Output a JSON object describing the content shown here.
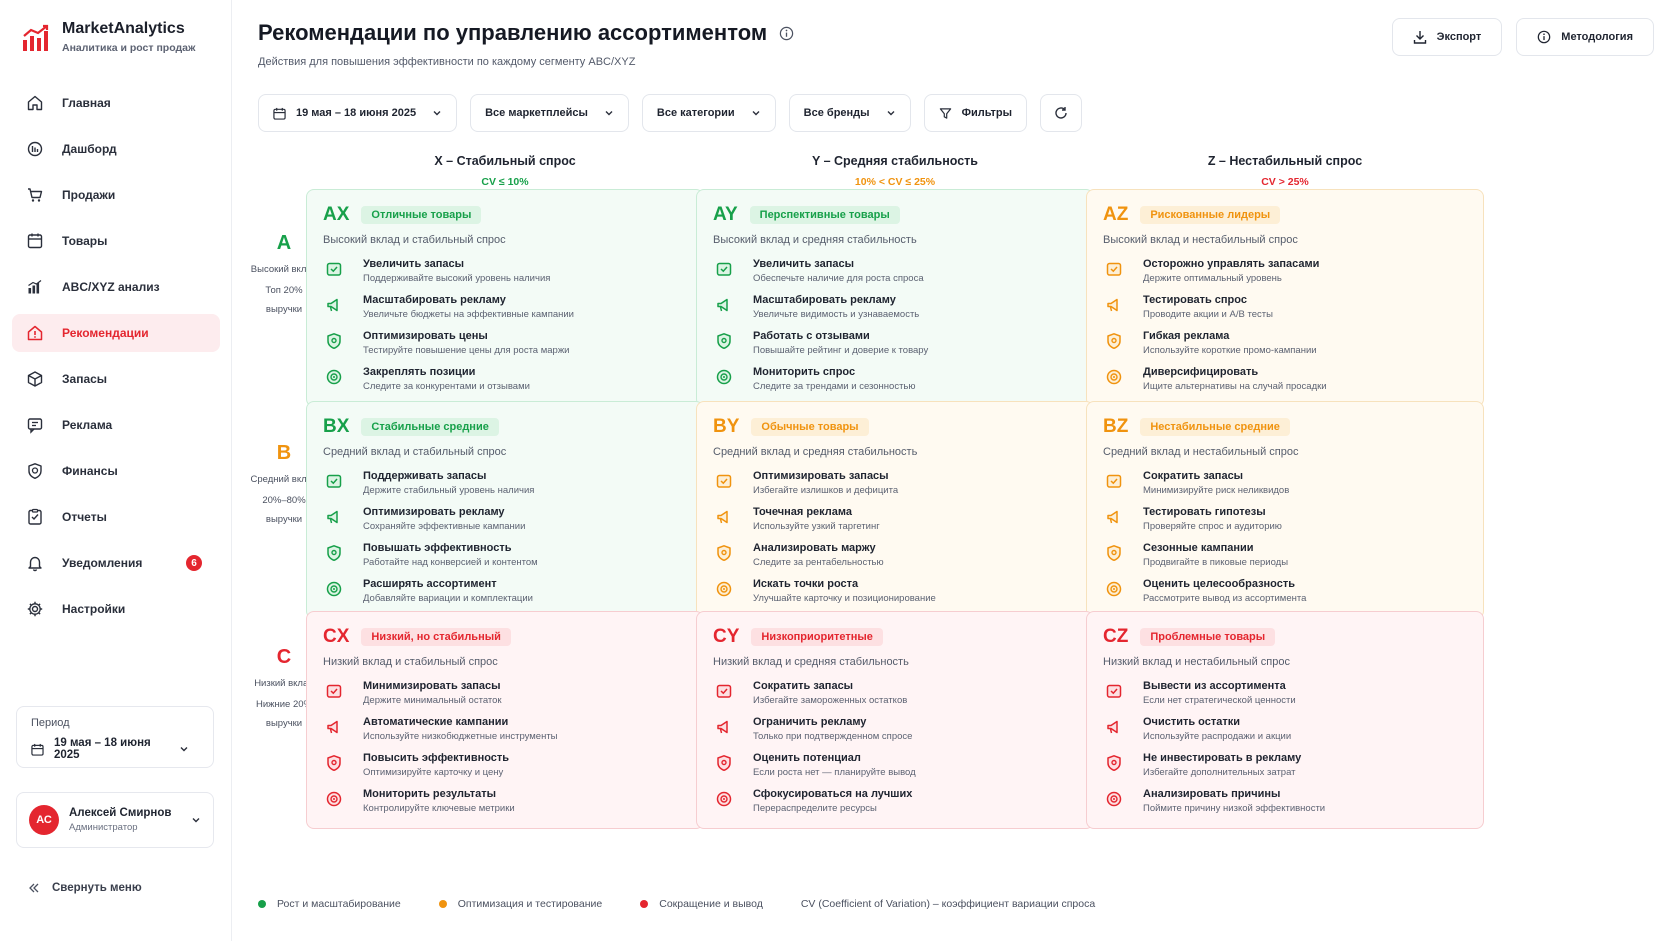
{
  "brand": {
    "title": "MarketAnalytics",
    "subtitle": "Аналитика и рост продаж"
  },
  "nav": [
    {
      "label": "Главная",
      "icon": "home-icon"
    },
    {
      "label": "Дашборд",
      "icon": "dashboard-icon"
    },
    {
      "label": "Продажи",
      "icon": "cart-icon"
    },
    {
      "label": "Товары",
      "icon": "box-icon"
    },
    {
      "label": "ABC/XYZ анализ",
      "icon": "bar-chart-icon"
    },
    {
      "label": "Рекомендации",
      "icon": "home-alert-icon",
      "active": true
    },
    {
      "label": "Запасы",
      "icon": "stock-icon"
    },
    {
      "label": "Реклама",
      "icon": "ad-icon"
    },
    {
      "label": "Финансы",
      "icon": "finance-icon"
    },
    {
      "label": "Отчеты",
      "icon": "report-icon"
    },
    {
      "label": "Уведомления",
      "icon": "bell-icon",
      "badge": "6"
    },
    {
      "label": "Настройки",
      "icon": "gear-icon"
    }
  ],
  "period": {
    "label": "Период",
    "value": "19 мая – 18 июня 2025"
  },
  "user": {
    "initials": "АС",
    "name": "Алексей Смирнов",
    "role": "Администратор"
  },
  "collapse_label": "Свернуть меню",
  "header": {
    "title": "Рекомендации по управлению ассортиментом",
    "subtitle": "Действия для повышения эффективности по каждому сегменту ABC/XYZ",
    "export_label": "Экспорт",
    "method_label": "Методология"
  },
  "filters": {
    "date": "19 мая – 18 июня 2025",
    "marketplaces": "Все маркетплейсы",
    "categories": "Все категории",
    "brands": "Все бренды",
    "filters_label": "Фильтры"
  },
  "columns": [
    {
      "title": "X – Стабильный спрос",
      "sub": "CV ≤ 10%",
      "color": "#17a04a"
    },
    {
      "title": "Y – Средняя стабильность",
      "sub": "10% < CV ≤ 25%",
      "color": "#f0930f"
    },
    {
      "title": "Z – Нестабильный спрос",
      "sub": "CV > 25%",
      "color": "#e4262f"
    }
  ],
  "rows": [
    {
      "letter": "A",
      "color": "#17a04a",
      "desc": "Высокий вклад",
      "pct": "Топ 20%",
      "unit": "выручки"
    },
    {
      "letter": "B",
      "color": "#f0930f",
      "desc": "Средний вклад",
      "pct": "20%–80%",
      "unit": "выручки"
    },
    {
      "letter": "C",
      "color": "#e4262f",
      "desc": "Низкий вклад",
      "pct": "Нижние 20%",
      "unit": "выручки"
    }
  ],
  "cards": [
    {
      "code": "AX",
      "tone": "g",
      "tag": "Отличные товары",
      "desc": "Высокий вклад и стабильный спрос",
      "actions": [
        {
          "name": "Увеличить запасы",
          "desc": "Поддерживайте высокий уровень наличия"
        },
        {
          "name": "Масштабировать рекламу",
          "desc": "Увеличьте бюджеты на эффективные кампании"
        },
        {
          "name": "Оптимизировать цены",
          "desc": "Тестируйте повышение цены для роста маржи"
        },
        {
          "name": "Закреплять позиции",
          "desc": "Следите за конкурентами и отзывами"
        }
      ]
    },
    {
      "code": "AY",
      "tone": "g",
      "tag": "Перспективные товары",
      "desc": "Высокий вклад и средняя стабильность",
      "actions": [
        {
          "name": "Увеличить запасы",
          "desc": "Обеспечьте наличие для роста спроса"
        },
        {
          "name": "Масштабировать рекламу",
          "desc": "Увеличьте видимость и узнаваемость"
        },
        {
          "name": "Работать с отзывами",
          "desc": "Повышайте рейтинг и доверие к товару"
        },
        {
          "name": "Мониторить спрос",
          "desc": "Следите за трендами и сезонностью"
        }
      ]
    },
    {
      "code": "AZ",
      "tone": "o",
      "tag": "Рискованные лидеры",
      "desc": "Высокий вклад и нестабильный спрос",
      "actions": [
        {
          "name": "Осторожно управлять запасами",
          "desc": "Держите оптимальный уровень"
        },
        {
          "name": "Тестировать спрос",
          "desc": "Проводите акции и A/B тесты"
        },
        {
          "name": "Гибкая реклама",
          "desc": "Используйте короткие промо-кампании"
        },
        {
          "name": "Диверсифицировать",
          "desc": "Ищите альтернативы на случай просадки"
        }
      ]
    },
    {
      "code": "BX",
      "tone": "g",
      "tag": "Стабильные средние",
      "desc": "Средний вклад и стабильный спрос",
      "actions": [
        {
          "name": "Поддерживать запасы",
          "desc": "Держите стабильный уровень наличия"
        },
        {
          "name": "Оптимизировать рекламу",
          "desc": "Сохраняйте эффективные кампании"
        },
        {
          "name": "Повышать эффективность",
          "desc": "Работайте над конверсией и контентом"
        },
        {
          "name": "Расширять ассортимент",
          "desc": "Добавляйте вариации и комплектации"
        }
      ]
    },
    {
      "code": "BY",
      "tone": "o",
      "tag": "Обычные товары",
      "desc": "Средний вклад и средняя стабильность",
      "actions": [
        {
          "name": "Оптимизировать запасы",
          "desc": "Избегайте излишков и дефицита"
        },
        {
          "name": "Точечная реклама",
          "desc": "Используйте узкий таргетинг"
        },
        {
          "name": "Анализировать маржу",
          "desc": "Следите за рентабельностью"
        },
        {
          "name": "Искать точки роста",
          "desc": "Улучшайте карточку и позиционирование"
        }
      ]
    },
    {
      "code": "BZ",
      "tone": "o",
      "tag": "Нестабильные средние",
      "desc": "Средний вклад и нестабильный спрос",
      "actions": [
        {
          "name": "Сократить запасы",
          "desc": "Минимизируйте риск неликвидов"
        },
        {
          "name": "Тестировать гипотезы",
          "desc": "Проверяйте спрос и аудиторию"
        },
        {
          "name": "Сезонные кампании",
          "desc": "Продвигайте в пиковые периоды"
        },
        {
          "name": "Оценить целесообразность",
          "desc": "Рассмотрите вывод из ассортимента"
        }
      ]
    },
    {
      "code": "CX",
      "tone": "r",
      "tag": "Низкий, но стабильный",
      "desc": "Низкий вклад и стабильный спрос",
      "actions": [
        {
          "name": "Минимизировать запасы",
          "desc": "Держите минимальный остаток"
        },
        {
          "name": "Автоматические кампании",
          "desc": "Используйте низкобюджетные инструменты"
        },
        {
          "name": "Повысить эффективность",
          "desc": "Оптимизируйте карточку и цену"
        },
        {
          "name": "Мониторить результаты",
          "desc": "Контролируйте ключевые метрики"
        }
      ]
    },
    {
      "code": "CY",
      "tone": "r",
      "tag": "Низкоприоритетные",
      "desc": "Низкий вклад и средняя стабильность",
      "actions": [
        {
          "name": "Сократить запасы",
          "desc": "Избегайте замороженных остатков"
        },
        {
          "name": "Ограничить рекламу",
          "desc": "Только при подтвержденном спросе"
        },
        {
          "name": "Оценить потенциал",
          "desc": "Если роста нет — планируйте вывод"
        },
        {
          "name": "Сфокусироваться на лучших",
          "desc": "Перераспределите ресурсы"
        }
      ]
    },
    {
      "code": "CZ",
      "tone": "r",
      "tag": "Проблемные товары",
      "desc": "Низкий вклад и нестабильный спрос",
      "actions": [
        {
          "name": "Вывести из ассортимента",
          "desc": "Если нет стратегической ценности"
        },
        {
          "name": "Очистить остатки",
          "desc": "Используйте распродажи и акции"
        },
        {
          "name": "Не инвестировать в рекламу",
          "desc": "Избегайте дополнительных затрат"
        },
        {
          "name": "Анализировать причины",
          "desc": "Поймите причину низкой эффективности"
        }
      ]
    }
  ],
  "legend": [
    {
      "label": "Рост и масштабирование",
      "color": "#17a04a"
    },
    {
      "label": "Оптимизация и тестирование",
      "color": "#f0930f"
    },
    {
      "label": "Сокращение и вывод",
      "color": "#e4262f"
    }
  ],
  "legend_note": "CV (Coefficient of Variation) – коэффициент вариации спроса",
  "colors": {
    "accent": "#e4262f",
    "green": "#17a04a",
    "orange": "#f0930f"
  }
}
